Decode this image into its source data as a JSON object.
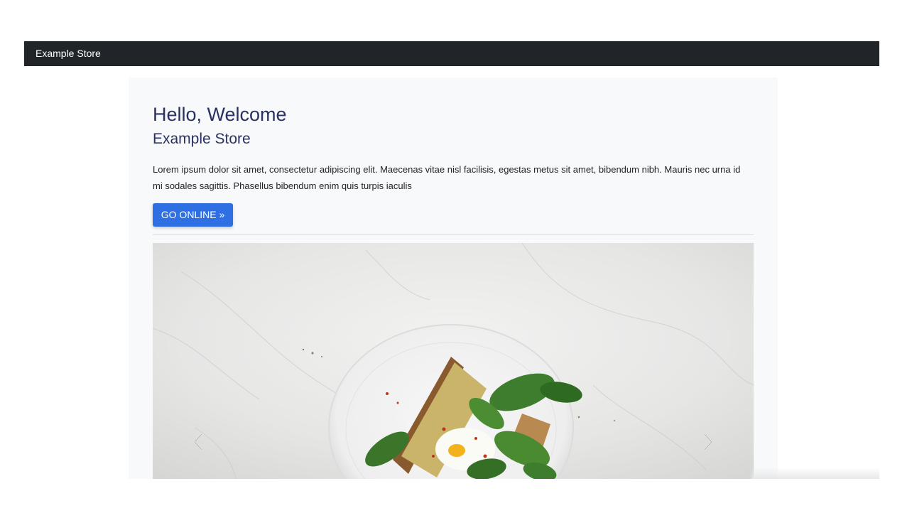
{
  "navbar": {
    "brand": "Example Store",
    "background": "#212529"
  },
  "hero": {
    "title": "Hello, Welcome",
    "subtitle": "Example Store",
    "lead": "Lorem ipsum dolor sit amet, consectetur adipiscing elit. Maecenas vitae nisl facilisis, egestas metus sit amet, bibendum nibh. Mauris nec urna id mi sodales sagittis. Phasellus bibendum enim quis turpis iaculis",
    "cta_label": "GO ONLINE »",
    "accent": "#2f6fe4",
    "heading_color": "#2b3162"
  },
  "carousel": {
    "slide_subject": "avocado toast with spinach and egg on white plate on marble",
    "prev_icon": "chevron-left-icon",
    "next_icon": "chevron-right-icon"
  }
}
